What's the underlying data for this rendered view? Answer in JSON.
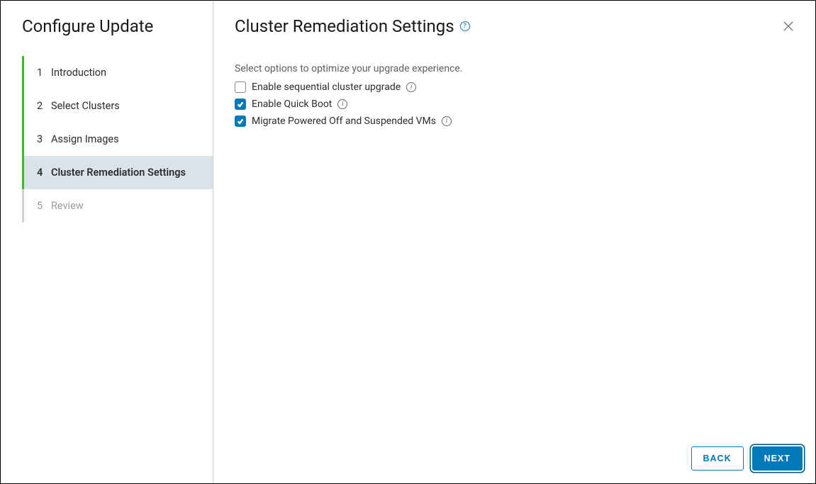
{
  "sidebar": {
    "title": "Configure Update",
    "steps": [
      {
        "num": "1",
        "label": "Introduction",
        "state": "completed"
      },
      {
        "num": "2",
        "label": "Select Clusters",
        "state": "completed"
      },
      {
        "num": "3",
        "label": "Assign Images",
        "state": "completed"
      },
      {
        "num": "4",
        "label": "Cluster Remediation Settings",
        "state": "active"
      },
      {
        "num": "5",
        "label": "Review",
        "state": "upcoming"
      }
    ]
  },
  "main": {
    "title": "Cluster Remediation Settings",
    "description": "Select options to optimize your upgrade experience.",
    "options": [
      {
        "label": "Enable sequential cluster upgrade",
        "checked": false
      },
      {
        "label": "Enable Quick Boot",
        "checked": true
      },
      {
        "label": "Migrate Powered Off and Suspended VMs",
        "checked": true
      }
    ]
  },
  "footer": {
    "back": "BACK",
    "next": "NEXT"
  }
}
